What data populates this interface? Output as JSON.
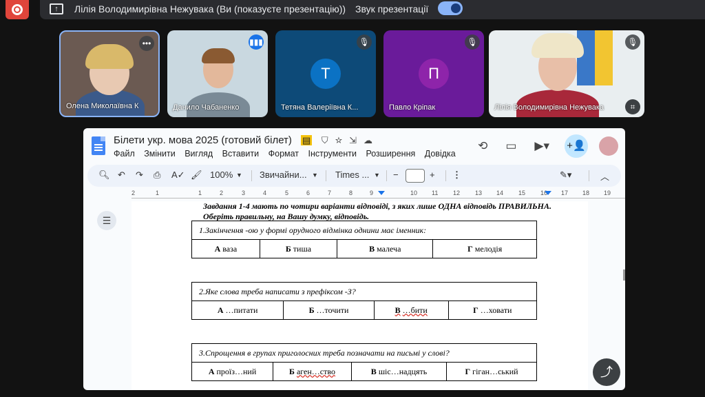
{
  "presenting_bar": {
    "text": "Лілія Володимирівна Нежувака (Ви (показуєте презентацію))",
    "sound_label": "Звук презентації",
    "sound_on": true
  },
  "participants": [
    {
      "name": "Олена Миколаївна К",
      "badge_icon": "more-options-icon"
    },
    {
      "name": "Данило Чабаненко",
      "badge_icon": "speaking-indicator-icon"
    },
    {
      "name": "Тетяна Валеріївна К...",
      "initial": "Т",
      "avatar_color": "#0b72c4",
      "tile_color": "#0d4a78",
      "badge_icon": "mic-off-icon"
    },
    {
      "name": "Павло Кріпак",
      "initial": "П",
      "avatar_color": "#7b1fa2",
      "tile_color": "#6a1b9a",
      "badge_icon": "mic-off-icon"
    },
    {
      "name": "Лілія Володимирівна Нежувака",
      "badge_icon": "mic-off-icon"
    }
  ],
  "doc": {
    "title": "Білети укр. мова 2025 (готовий білет)",
    "menu": [
      "Файл",
      "Змінити",
      "Вигляд",
      "Вставити",
      "Формат",
      "Інструменти",
      "Розширення",
      "Довідка"
    ],
    "toolbar": {
      "zoom": "100%",
      "style": "Звичайни...",
      "font": "Times ...",
      "font_size": ""
    },
    "ruler_numbers": [
      "2",
      "1",
      "1",
      "2",
      "3",
      "4",
      "5",
      "6",
      "7",
      "8",
      "9",
      "10",
      "11",
      "12",
      "13",
      "14",
      "15",
      "16",
      "17",
      "18",
      "19"
    ],
    "instruction_line1": "Завдання 1-4 мають по чотири варіанти відповіді, з яких лише ОДНА відповідь ПРАВИЛЬНА.",
    "instruction_line2": "Оберіть правильну, на Вашу думку, відповідь.",
    "questions": [
      {
        "text": "1.Закінчення -ою у формі орудного відмінка однини має іменник:",
        "options": [
          {
            "letter": "А",
            "text": "ваза"
          },
          {
            "letter": "Б",
            "text": "тиша"
          },
          {
            "letter": "В",
            "text": "малеча"
          },
          {
            "letter": "Г",
            "text": "мелодія"
          }
        ]
      },
      {
        "text": "2.Яке слова треба написати з префіксом -З?",
        "options": [
          {
            "letter": "А",
            "text": "…питати"
          },
          {
            "letter": "Б",
            "text": "…точити"
          },
          {
            "letter": "В",
            "text": "…бити"
          },
          {
            "letter": "Г",
            "text": "…ховати"
          }
        ]
      },
      {
        "text": "3.Спрощення в групах приголосних треба позначати на письмі у слові?",
        "options": [
          {
            "letter": "А",
            "text": "проїз…ний"
          },
          {
            "letter": "Б",
            "text": "аген…ство"
          },
          {
            "letter": "В",
            "text": "шіс…надцять"
          },
          {
            "letter": "Г",
            "text": "гіган…ський"
          }
        ]
      }
    ]
  }
}
